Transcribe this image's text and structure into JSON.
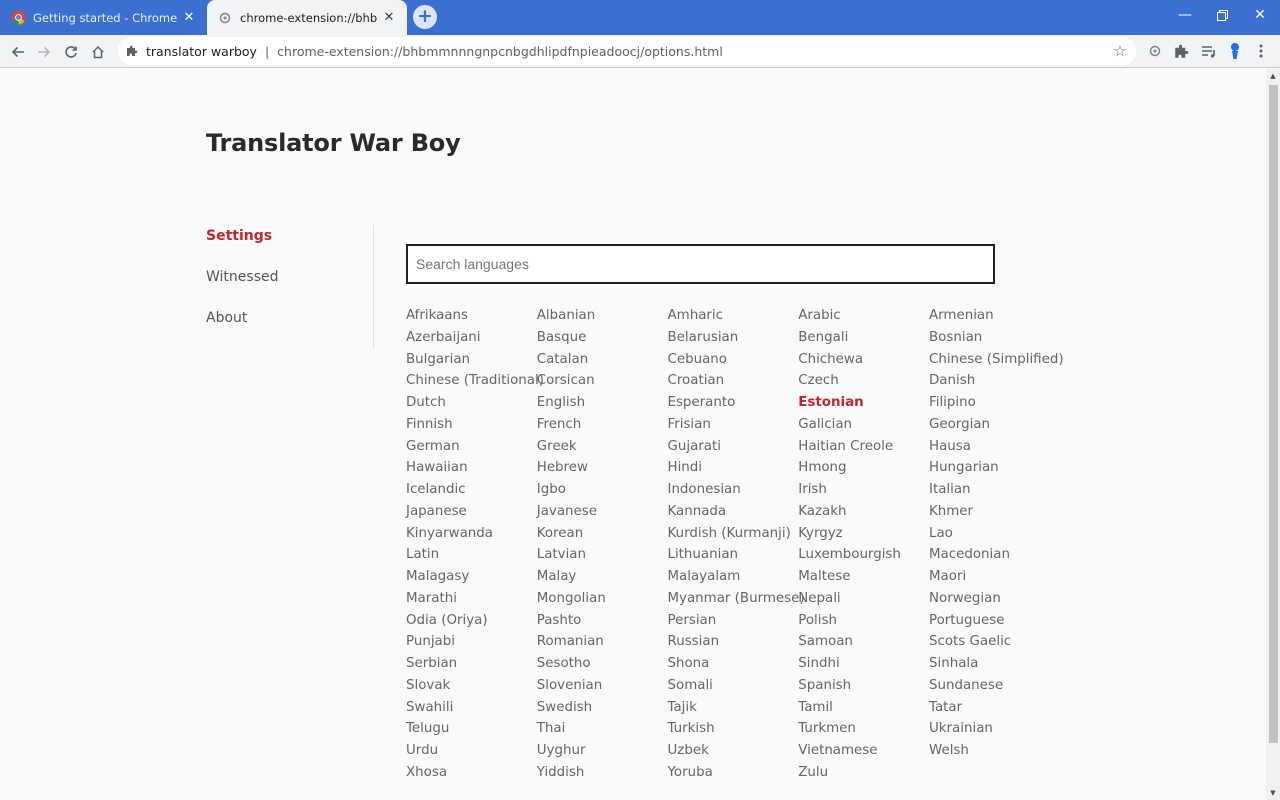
{
  "browser": {
    "tabs": [
      {
        "title": "Getting started - Chrome Devel",
        "active": false,
        "icon": "chrome-icon"
      },
      {
        "title": "chrome-extension://bhbmmnnn",
        "active": true,
        "icon": "extension-icon"
      }
    ],
    "address": {
      "origin": "translator warboy",
      "url": "chrome-extension://bhbmmnnngnpcnbgdhlipdfnpieadoocj/options.html"
    }
  },
  "app": {
    "title": "Translator War Boy",
    "nav": [
      "Settings",
      "Witnessed",
      "About"
    ],
    "active_nav": "Settings",
    "search_placeholder": "Search languages",
    "accent_color": "#c0272d",
    "selected_language": "Estonian",
    "languages": [
      "Afrikaans",
      "Albanian",
      "Amharic",
      "Arabic",
      "Armenian",
      "Azerbaijani",
      "Basque",
      "Belarusian",
      "Bengali",
      "Bosnian",
      "Bulgarian",
      "Catalan",
      "Cebuano",
      "Chichewa",
      "Chinese (Simplified)",
      "Chinese (Traditional)",
      "Corsican",
      "Croatian",
      "Czech",
      "Danish",
      "Dutch",
      "English",
      "Esperanto",
      "Estonian",
      "Filipino",
      "Finnish",
      "French",
      "Frisian",
      "Galician",
      "Georgian",
      "German",
      "Greek",
      "Gujarati",
      "Haitian Creole",
      "Hausa",
      "Hawaiian",
      "Hebrew",
      "Hindi",
      "Hmong",
      "Hungarian",
      "Icelandic",
      "Igbo",
      "Indonesian",
      "Irish",
      "Italian",
      "Japanese",
      "Javanese",
      "Kannada",
      "Kazakh",
      "Khmer",
      "Kinyarwanda",
      "Korean",
      "Kurdish (Kurmanji)",
      "Kyrgyz",
      "Lao",
      "Latin",
      "Latvian",
      "Lithuanian",
      "Luxembourgish",
      "Macedonian",
      "Malagasy",
      "Malay",
      "Malayalam",
      "Maltese",
      "Maori",
      "Marathi",
      "Mongolian",
      "Myanmar (Burmese)",
      "Nepali",
      "Norwegian",
      "Odia (Oriya)",
      "Pashto",
      "Persian",
      "Polish",
      "Portuguese",
      "Punjabi",
      "Romanian",
      "Russian",
      "Samoan",
      "Scots Gaelic",
      "Serbian",
      "Sesotho",
      "Shona",
      "Sindhi",
      "Sinhala",
      "Slovak",
      "Slovenian",
      "Somali",
      "Spanish",
      "Sundanese",
      "Swahili",
      "Swedish",
      "Tajik",
      "Tamil",
      "Tatar",
      "Telugu",
      "Thai",
      "Turkish",
      "Turkmen",
      "Ukrainian",
      "Urdu",
      "Uyghur",
      "Uzbek",
      "Vietnamese",
      "Welsh",
      "Xhosa",
      "Yiddish",
      "Yoruba",
      "Zulu"
    ]
  }
}
